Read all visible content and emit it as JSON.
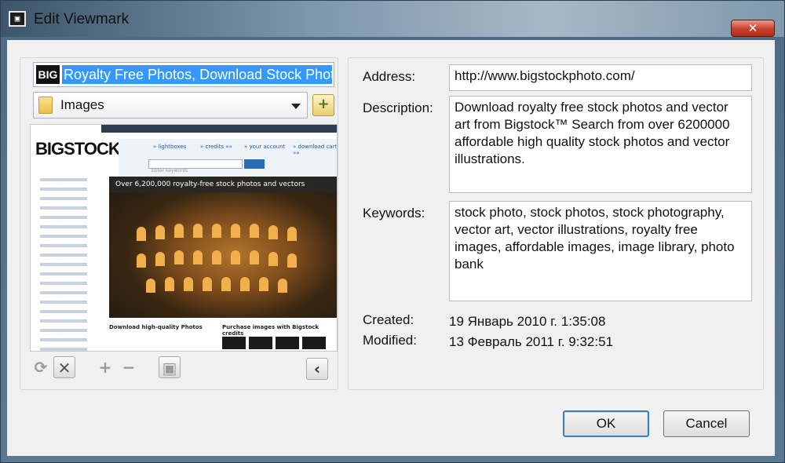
{
  "window": {
    "title": "Edit Viewmark",
    "close_glyph": "✕"
  },
  "bookmark": {
    "logo_text": "BIG",
    "title": "Royalty Free Photos, Download Stock Photos"
  },
  "folder": {
    "selected": "Images"
  },
  "preview": {
    "logo": "BIGSTOCK",
    "banner": "Over 6,200,000 royalty-free stock photos and vectors",
    "nav": [
      "» lightboxes",
      "» credits »»",
      "» your account",
      "» download cart »»"
    ],
    "search_placeholder": "Enter keywords",
    "foot_left": "Download high-quality Photos",
    "foot_right": "Purchase images with Bigstock credits"
  },
  "fields": {
    "address_label": "Address:",
    "address_value": "http://www.bigstockphoto.com/",
    "description_label": "Description:",
    "description_value": "Download royalty free stock photos and vector art from Bigstock™ Search from over 6200000 affordable high quality stock photos and vector illustrations.",
    "keywords_label": "Keywords:",
    "keywords_value": "stock photo, stock photos, stock photography, vector art, vector illustrations, royalty free images, affordable images, image library, photo bank",
    "created_label": "Created:",
    "created_value": "19 Январь 2010 г. 1:35:08",
    "modified_label": "Modified:",
    "modified_value": "13 Февраль 2011 г. 9:32:51"
  },
  "buttons": {
    "ok": "OK",
    "cancel": "Cancel"
  },
  "toolbar": {
    "refresh_icon": "⟳",
    "delete_icon": "✕",
    "add_icon": "+",
    "remove_icon": "−",
    "save_icon": "▣",
    "collapse_icon": "‹"
  }
}
